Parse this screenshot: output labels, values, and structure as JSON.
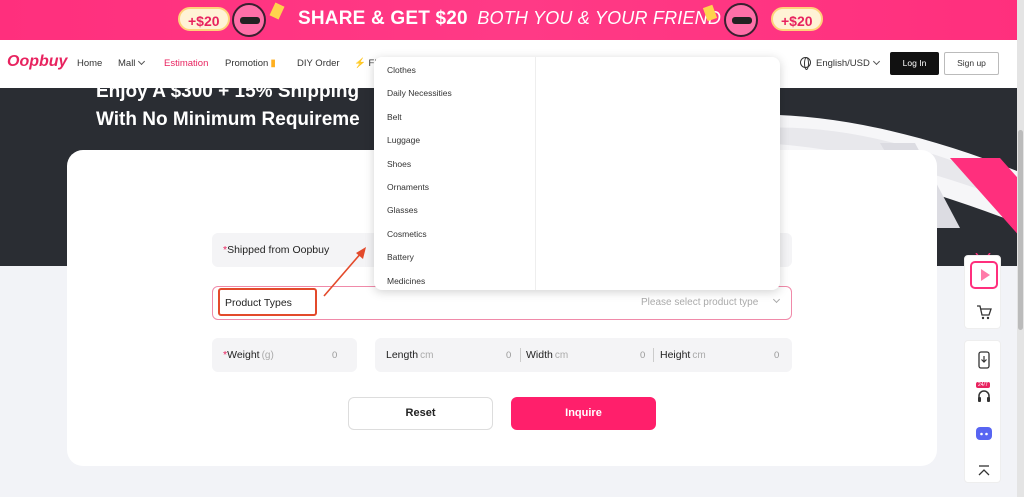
{
  "promo": {
    "coin_left": "+$20",
    "coin_right": "+$20",
    "headline": "SHARE & GET $20",
    "subline": "BOTH YOU & YOUR FRIEND"
  },
  "nav": {
    "logo": "Oopbuy",
    "items": [
      "Home",
      "Mall",
      "Estimation",
      "Promotion",
      "DIY Order",
      "FL"
    ],
    "language": "English/USD",
    "login": "Log In",
    "signup": "Sign up"
  },
  "hero": {
    "line1": "Enjoy A $300 + 15% Shipping",
    "line2": "With No Minimum Requireme"
  },
  "form": {
    "shipped_from": "Shipped from Oopbuy",
    "product_types_label": "Product Types",
    "product_types_placeholder": "Please select product type",
    "weight_label": "Weight",
    "weight_unit": "(g)",
    "weight_value": "0",
    "length_label": "Length",
    "width_label": "Width",
    "height_label": "Height",
    "dim_unit": "cm",
    "length_value": "0",
    "width_value": "0",
    "height_value": "0",
    "reset": "Reset",
    "inquire": "Inquire"
  },
  "dropdown": {
    "items": [
      "Clothes",
      "Daily Necessities",
      "Belt",
      "Luggage",
      "Shoes",
      "Ornaments",
      "Glasses",
      "Cosmetics",
      "Battery",
      "Medicines"
    ]
  },
  "sidebar": {
    "badge": "24/7"
  },
  "colors": {
    "brand": "#e8235f",
    "primary_button": "#ff1f6b",
    "annotation": "#e34a2b"
  }
}
